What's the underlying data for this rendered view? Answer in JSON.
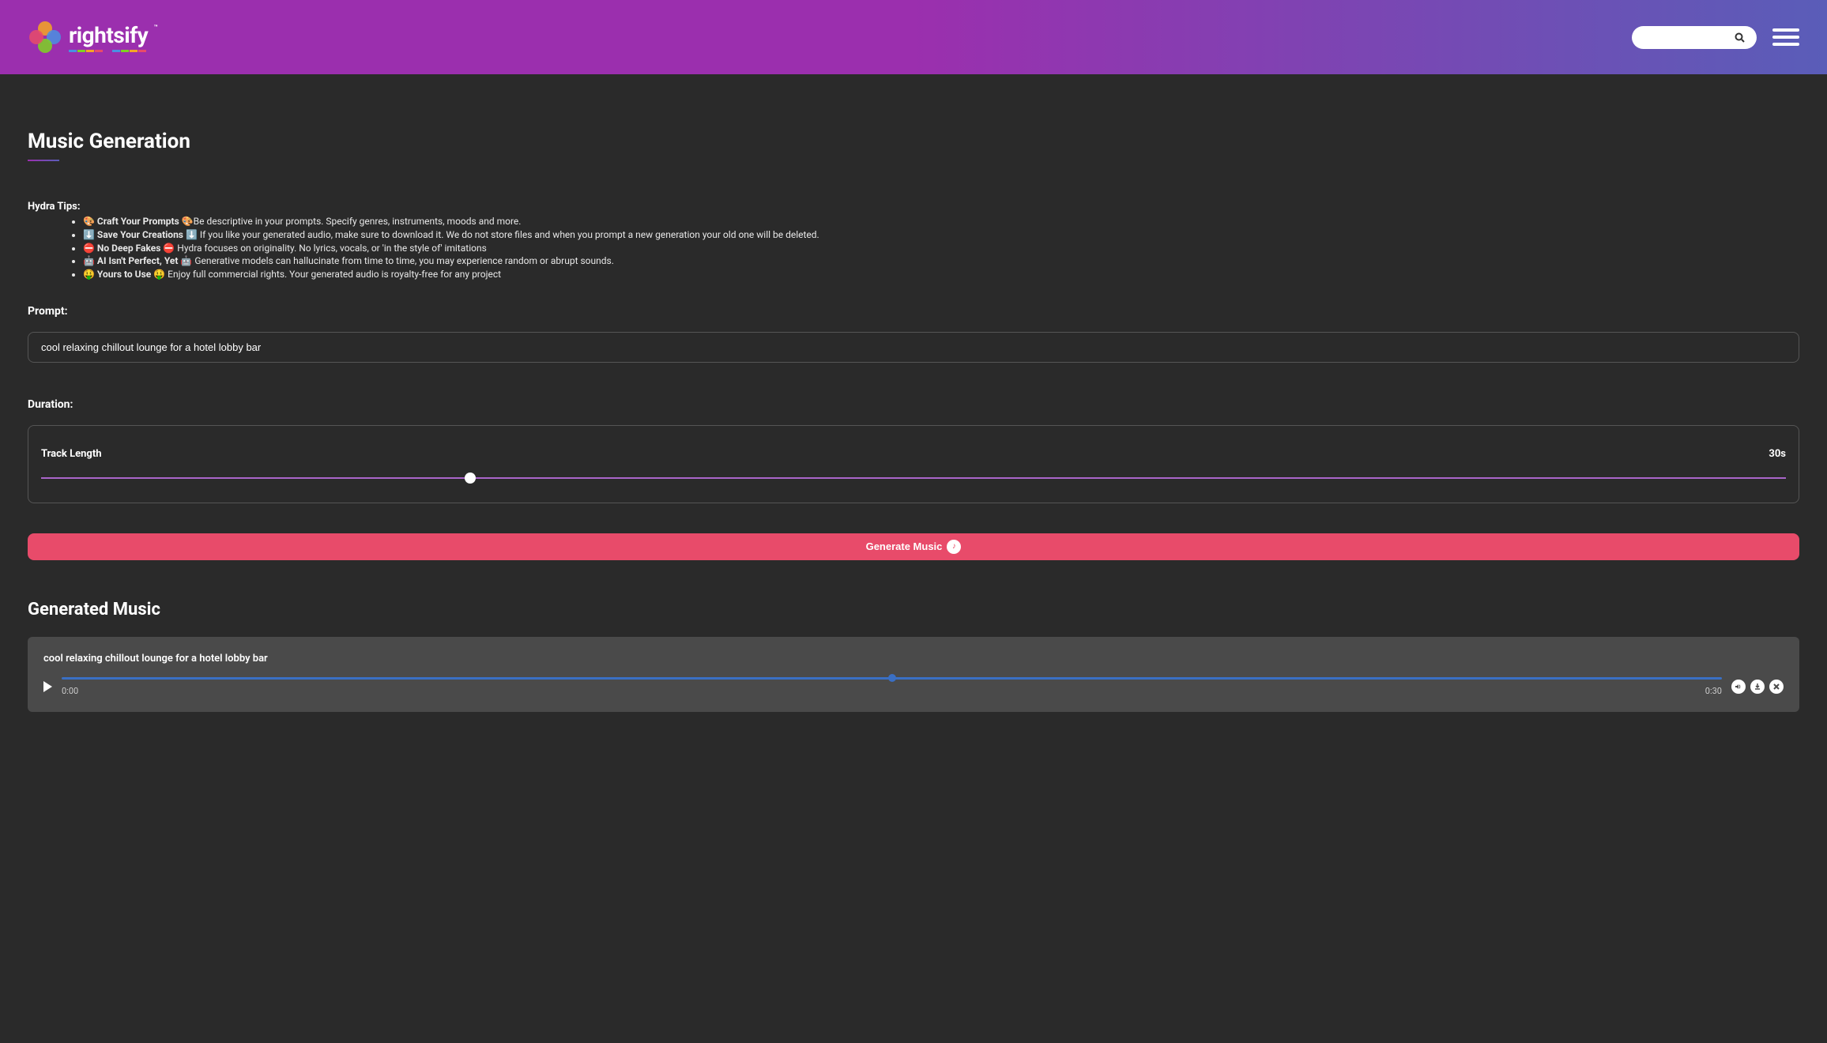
{
  "header": {
    "logo_text": "rightsify",
    "logo_tm": "™"
  },
  "page": {
    "title": "Music Generation",
    "tips_title": "Hydra Tips:",
    "tips": [
      {
        "bold": "🎨 Craft Your Prompts 🎨",
        "text": "Be descriptive in your prompts. Specify genres, instruments, moods and more."
      },
      {
        "bold": "⬇️ Save Your Creations ⬇️",
        "text": " If you like your generated audio, make sure to download it. We do not store files and when you prompt a new generation your old one will be deleted."
      },
      {
        "bold": "⛔ No Deep Fakes ⛔",
        "text": " Hydra focuses on originality. No lyrics, vocals, or 'in the style of' imitations"
      },
      {
        "bold": "🤖 AI Isn't Perfect, Yet 🤖",
        "text": " Generative models can hallucinate from time to time, you may experience random or abrupt sounds."
      },
      {
        "bold": "🤑 Yours to Use 🤑",
        "text": " Enjoy full commercial rights. Your generated audio is royalty-free for any project"
      }
    ],
    "prompt_label": "Prompt:",
    "prompt_value": "cool relaxing chillout lounge for a hotel lobby bar",
    "duration_label": "Duration:",
    "track_length_label": "Track Length",
    "track_length_value": "30s",
    "slider_percent": 24.6,
    "generate_label": "Generate Music",
    "generated_title": "Generated Music"
  },
  "player": {
    "title": "cool relaxing chillout lounge for a hotel lobby bar",
    "current_time": "0:00",
    "total_time": "0:30",
    "progress_percent": 50
  }
}
